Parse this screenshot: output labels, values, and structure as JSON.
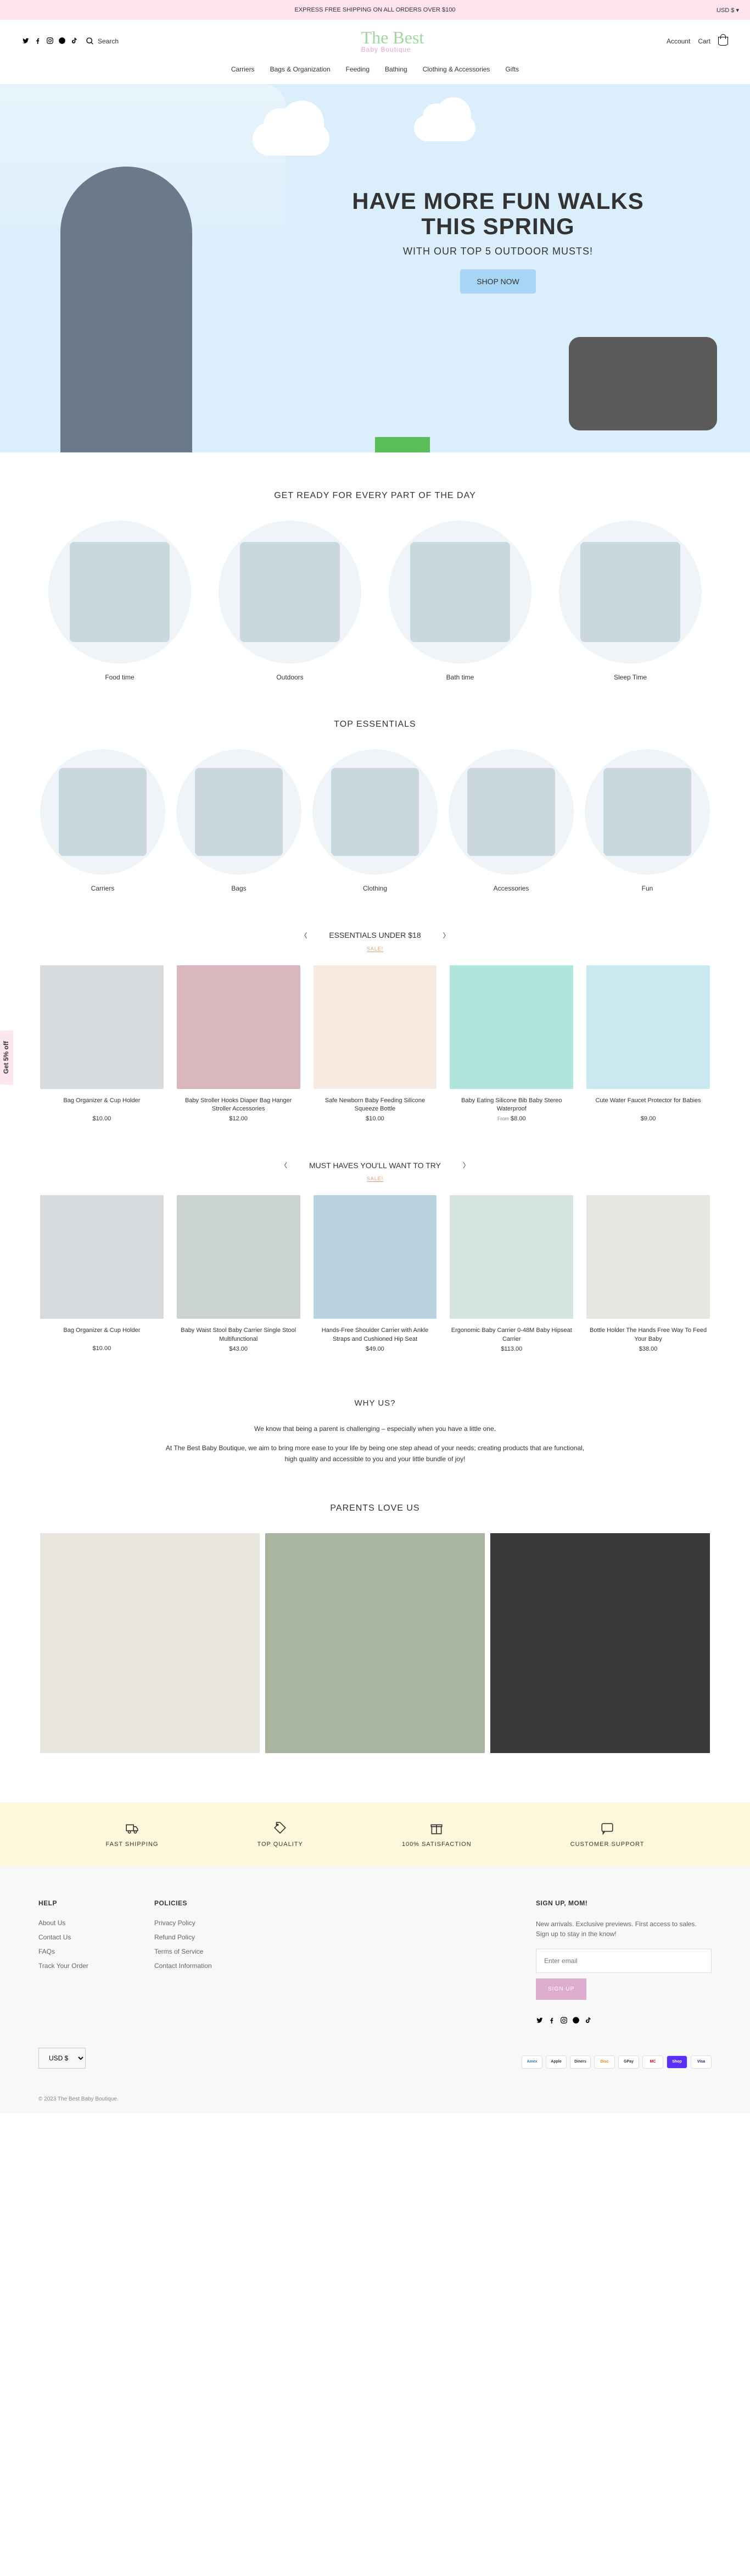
{
  "announcement": {
    "msg": "EXPRESS FREE SHIPPING ON ALL ORDERS OVER $100",
    "currency": "USD $ ▾"
  },
  "header": {
    "search": "Search",
    "logo_top": "The Best",
    "logo_bottom": "Baby Boutique",
    "account": "Account",
    "cart": "Cart"
  },
  "nav": [
    "Carriers",
    "Bags & Organization",
    "Feeding",
    "Bathing",
    "Clothing & Accessories",
    "Gifts"
  ],
  "hero": {
    "title1": "HAVE MORE FUN WALKS",
    "title2": "THIS SPRING",
    "sub": "WITH OUR TOP 5 OUTDOOR MUSTS!",
    "btn": "SHOP NOW"
  },
  "day": {
    "title": "GET READY FOR EVERY PART OF THE DAY",
    "items": [
      "Food time",
      "Outdoors",
      "Bath time",
      "Sleep Time"
    ]
  },
  "essentials": {
    "title": "TOP ESSENTIALS",
    "items": [
      "Carriers",
      "Bags",
      "Clothing",
      "Accessories",
      "Fun"
    ]
  },
  "under18": {
    "title": "ESSENTIALS UNDER $18",
    "tag": "SALE!",
    "products": [
      {
        "name": "Bag Organizer & Cup Holder",
        "price": "$10.00"
      },
      {
        "name": "Baby Stroller Hooks Diaper Bag Hanger Stroller Accessories",
        "price": "$12.00"
      },
      {
        "name": "Safe Newborn Baby Feeding Silicone Squeeze Bottle",
        "price": "$10.00"
      },
      {
        "name": "Baby Eating Silicone Bib Baby Stereo Waterproof",
        "from": "From",
        "price": "$8.00"
      },
      {
        "name": "Cute Water Faucet Protector for Babies",
        "price": "$9.00"
      }
    ]
  },
  "musthaves": {
    "title": "MUST HAVES YOU'LL WANT TO TRY",
    "tag": "SALE!",
    "products": [
      {
        "name": "Bag Organizer & Cup Holder",
        "price": "$10.00"
      },
      {
        "name": "Baby Waist Stool Baby Carrier Single Stool Multifunctional",
        "price": "$43.00"
      },
      {
        "name": "Hands-Free Shoulder Carrier with Ankle Straps and Cushioned Hip Seat",
        "price": "$49.00"
      },
      {
        "name": "Ergonomic Baby Carrier 0-48M Baby Hipseat Carrier",
        "price": "$113.00"
      },
      {
        "name": "Bottle Holder The Hands Free Way To Feed Your Baby",
        "price": "$38.00"
      }
    ]
  },
  "whyus": {
    "title": "WHY US?",
    "p1": "We know that being a parent is challenging – especially when you have a little one.",
    "p2": "At The Best Baby Boutique, we aim to bring more ease to your life by being one step ahead of your needs; creating products that are functional, high quality and accessible to you and your little bundle of joy!"
  },
  "reviews": {
    "title": "PARENTS LOVE US"
  },
  "perks": [
    "FAST SHIPPING",
    "TOP QUALITY",
    "100% SATISFACTION",
    "CUSTOMER SUPPORT"
  ],
  "footer": {
    "help_title": "HELP",
    "help": [
      "About Us",
      "Contact Us",
      "FAQs",
      "Track Your Order"
    ],
    "policies_title": "POLICIES",
    "policies": [
      "Privacy Policy",
      "Refund Policy",
      "Terms of Service",
      "Contact Information"
    ],
    "signup_title": "SIGN UP, MOM!",
    "signup_text": "New arrivals. Exclusive previews. First access to sales. Sign up to stay in the know!",
    "email_ph": "Enter email",
    "btn": "SIGN UP"
  },
  "bottom": {
    "currency": "USD $",
    "payments": [
      "Amex",
      "Apple",
      "Diners",
      "Disc",
      "GPay",
      "MC",
      "Shop",
      "Visa"
    ],
    "copyright": "© 2023 The Best Baby Boutique."
  },
  "side_promo": "Get 5% off"
}
